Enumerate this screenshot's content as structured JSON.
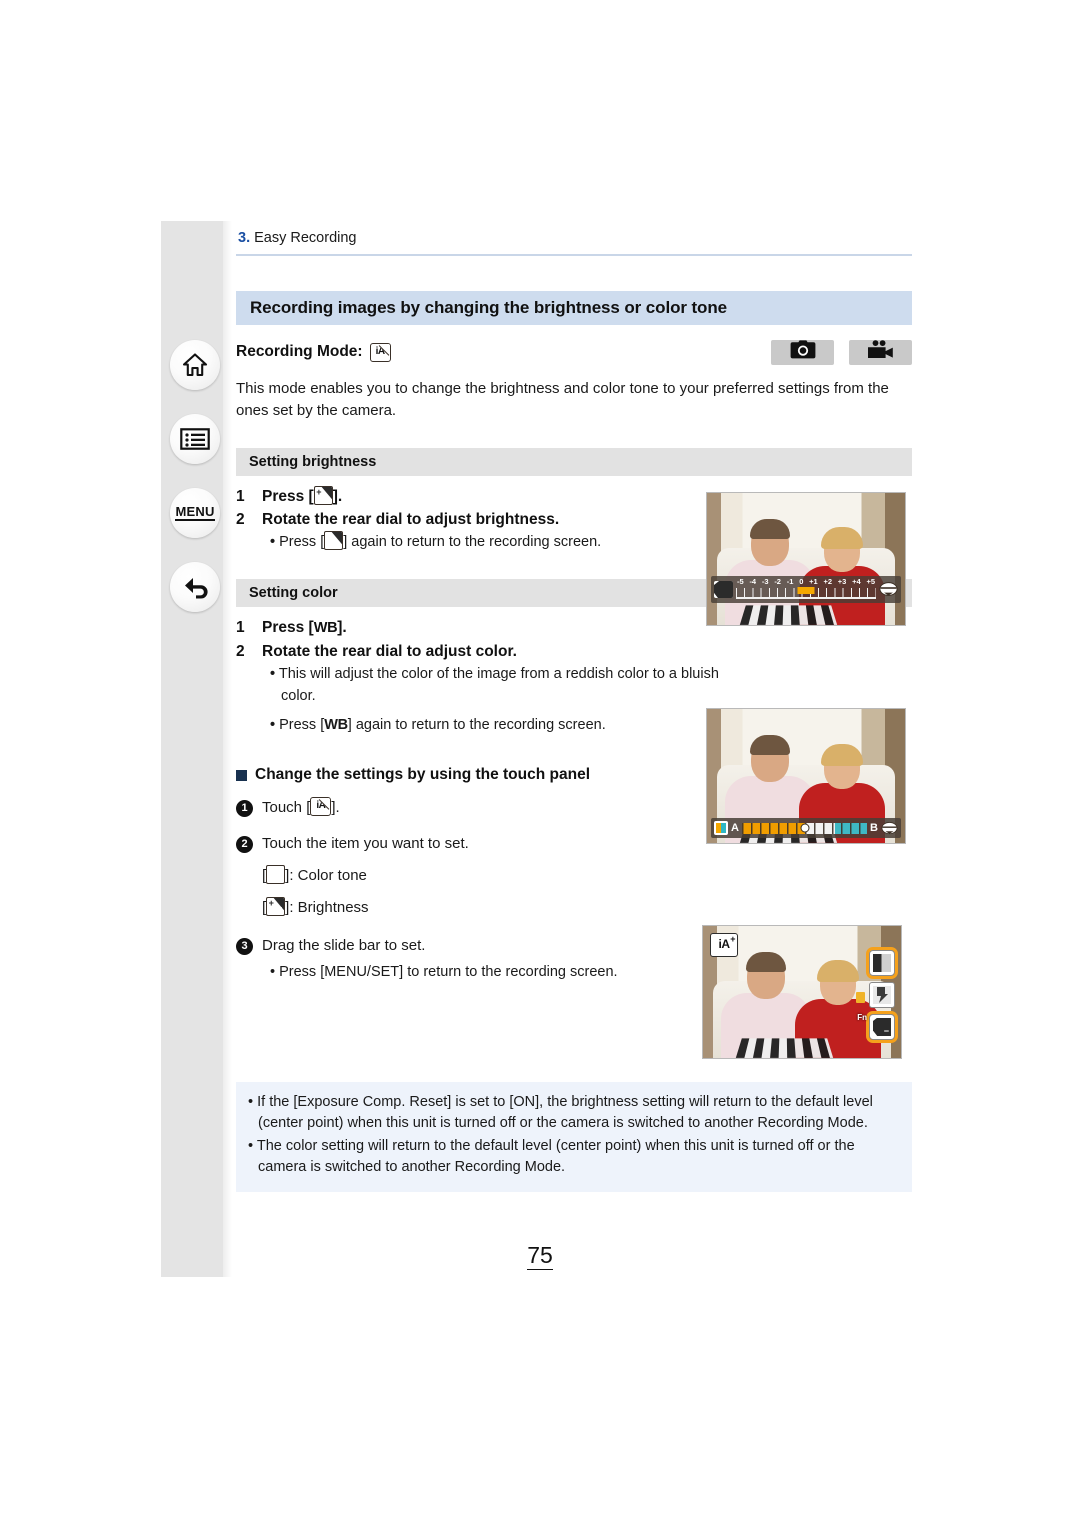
{
  "nav": {
    "items": [
      {
        "name": "home",
        "label": "Home"
      },
      {
        "name": "contents",
        "label": "Contents"
      },
      {
        "name": "menu",
        "label": "MENU"
      },
      {
        "name": "back",
        "label": "Back"
      }
    ]
  },
  "breadcrumb": {
    "chapter": "3.",
    "title": "Easy Recording"
  },
  "header": {
    "title": "Recording images by changing the brightness or color tone",
    "recording_mode_label": "Recording Mode:",
    "recording_mode_icon": "ia-plus-icon",
    "badges": [
      {
        "name": "photo-mode-badge",
        "icon": "camera-icon"
      },
      {
        "name": "video-mode-badge",
        "icon": "video-camera-icon"
      }
    ],
    "intro": "This mode enables you to change the brightness and color tone to your preferred settings from the ones set by the camera."
  },
  "brightness": {
    "heading": "Setting brightness",
    "step1_num": "1",
    "step1_a": "Press [",
    "step1_b": "].",
    "step2_num": "2",
    "step2": "Rotate the rear dial to adjust brightness.",
    "bullet_a": "Press [",
    "bullet_b": "] again to return to the recording screen."
  },
  "color": {
    "heading": "Setting color",
    "step1_num": "1",
    "step1_a": "Press [",
    "step1_icon": "WB",
    "step1_b": "].",
    "step2_num": "2",
    "step2": "Rotate the rear dial to adjust color.",
    "bullet1": "This will adjust the color of the image from a reddish color to a bluish color.",
    "bullet2_a": "Press [",
    "bullet2_icon": "WB",
    "bullet2_b": "] again to return to the recording screen."
  },
  "touch_panel": {
    "heading": "Change the settings by using the touch panel",
    "step1_num": "1",
    "step1_a": "Touch [",
    "step1_b": "].",
    "step2_num": "2",
    "step2": "Touch the item you want to set.",
    "legend": [
      {
        "icon": "color-tone-icon",
        "prefix": "[",
        "suffix": "]: Color tone"
      },
      {
        "icon": "brightness-icon",
        "prefix": "[",
        "suffix": "]: Brightness"
      }
    ],
    "step3_num": "3",
    "step3": "Drag the slide bar to set.",
    "step3_bullet": "Press [MENU/SET] to return to the recording screen."
  },
  "notes": [
    "If the [Exposure Comp. Reset] is set to [ON], the brightness setting will return to the default level (center point) when this unit is turned off or the camera is switched to another Recording Mode.",
    "The color setting will return to the default level (center point) when this unit is turned off or the camera is switched to another Recording Mode."
  ],
  "screenshots": {
    "brightness_shot": {
      "name": "exposure-compensation-screen",
      "scale_values": [
        "-5",
        "-4",
        "-3",
        "-2",
        "-1",
        "0",
        "+1",
        "+2",
        "+3",
        "+4",
        "+5"
      ],
      "marker_value": "0"
    },
    "color_shot": {
      "name": "white-balance-screen",
      "left_letter": "A",
      "right_letter": "B",
      "marker_value": "0"
    },
    "touch_shot": {
      "name": "touch-panel-screen",
      "mode_badge": "iA",
      "mode_badge_plus": "+",
      "fn_label": "Fn"
    }
  },
  "page_number": "75",
  "colors": {
    "title_banner": "#cedcee",
    "section_header": "#e2e2e2",
    "note_box": "#eef3fb",
    "chapter_blue": "#1a4fa3",
    "highlight_orange": "#f5a11c",
    "rail_gray": "#e4e4e4"
  }
}
